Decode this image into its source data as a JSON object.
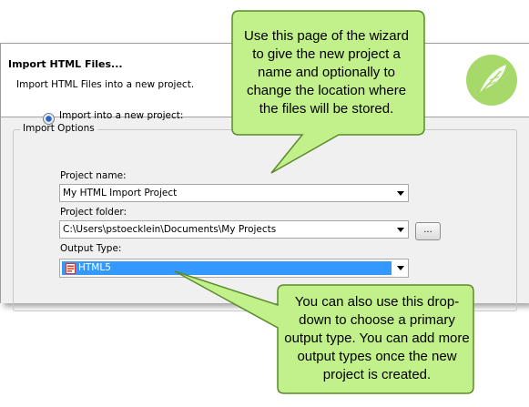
{
  "wizard": {
    "title": "Import HTML Files...",
    "description": "Import HTML Files into a new project.",
    "group_label": "Import Options",
    "radio_label": "Import into a new project:",
    "project_name_label": "Project name:",
    "project_name_value": "My HTML Import Project",
    "project_folder_label": "Project folder:",
    "project_folder_value": "C:\\Users\\pstoecklein\\Documents\\My Projects",
    "browse_label": "...",
    "output_type_label": "Output Type:",
    "output_type_value": "HTML5",
    "output_type_icon": "html5-icon",
    "logo_icon": "feather-logo-icon"
  },
  "callouts": {
    "top": "Use this page of the wizard to give the new project a name and optionally to change the location where the files will be stored.",
    "bottom": "You can also use this drop-down to choose a primary output type. You can add more output types once the new project is created."
  },
  "colors": {
    "callout_fill": "#c2f08a",
    "callout_stroke": "#5b8a2b",
    "selection": "#3399ff",
    "logo": "#a6d86a"
  }
}
